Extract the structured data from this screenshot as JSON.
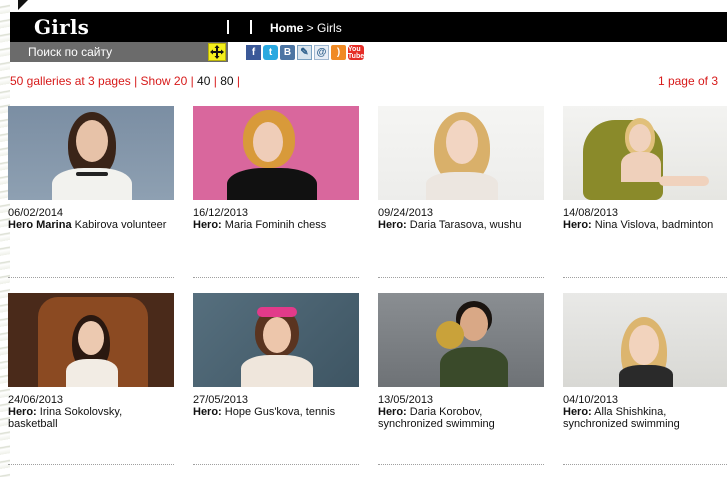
{
  "header": {
    "title": "Girls",
    "breadcrumb_home": "Home",
    "breadcrumb_sep": " > ",
    "breadcrumb_current": "Girls"
  },
  "search": {
    "label": "Поиск по сайту"
  },
  "social": [
    {
      "name": "facebook-icon",
      "glyph": "f"
    },
    {
      "name": "twitter-icon",
      "glyph": "t"
    },
    {
      "name": "vkontakte-icon",
      "glyph": "B"
    },
    {
      "name": "livejournal-icon",
      "glyph": "✎"
    },
    {
      "name": "mail-icon",
      "glyph": "@"
    },
    {
      "name": "rss-icon",
      "glyph": ")"
    },
    {
      "name": "youtube-icon",
      "glyph": "You Tube"
    }
  ],
  "pager": {
    "summary": "50 galleries at 3 pages",
    "show_label": "Show 20",
    "opt_40": "40",
    "opt_80": "80",
    "page_info": "1 page of 3"
  },
  "galleries": [
    {
      "date": "06/02/2014",
      "hero": "Hero Marina",
      "text": " Kabirova volunteer"
    },
    {
      "date": "16/12/2013",
      "hero": "Hero:",
      "text": " Maria Fominih chess"
    },
    {
      "date": "09/24/2013",
      "hero": "Hero:",
      "text": " Daria Tarasova, wushu"
    },
    {
      "date": "14/08/2013",
      "hero": "Hero:",
      "text": " Nina Vislova, badminton"
    },
    {
      "date": "24/06/2013",
      "hero": "Hero:",
      "text": " Irina Sokolovsky, basketball"
    },
    {
      "date": "27/05/2013",
      "hero": "Hero:",
      "text": " Hope Gus'kova, tennis"
    },
    {
      "date": "13/05/2013",
      "hero": "Hero:",
      "text": " Daria Korobov, synchronized swimming"
    },
    {
      "date": "04/10/2013",
      "hero": "Hero:",
      "text": " Alla Shishkina, synchronized swimming"
    }
  ],
  "colors": {
    "link_red": "#d71a1a",
    "header_black": "#000000",
    "search_grey": "#6b6b6b",
    "plus_yellow": "#f4ef1c"
  }
}
